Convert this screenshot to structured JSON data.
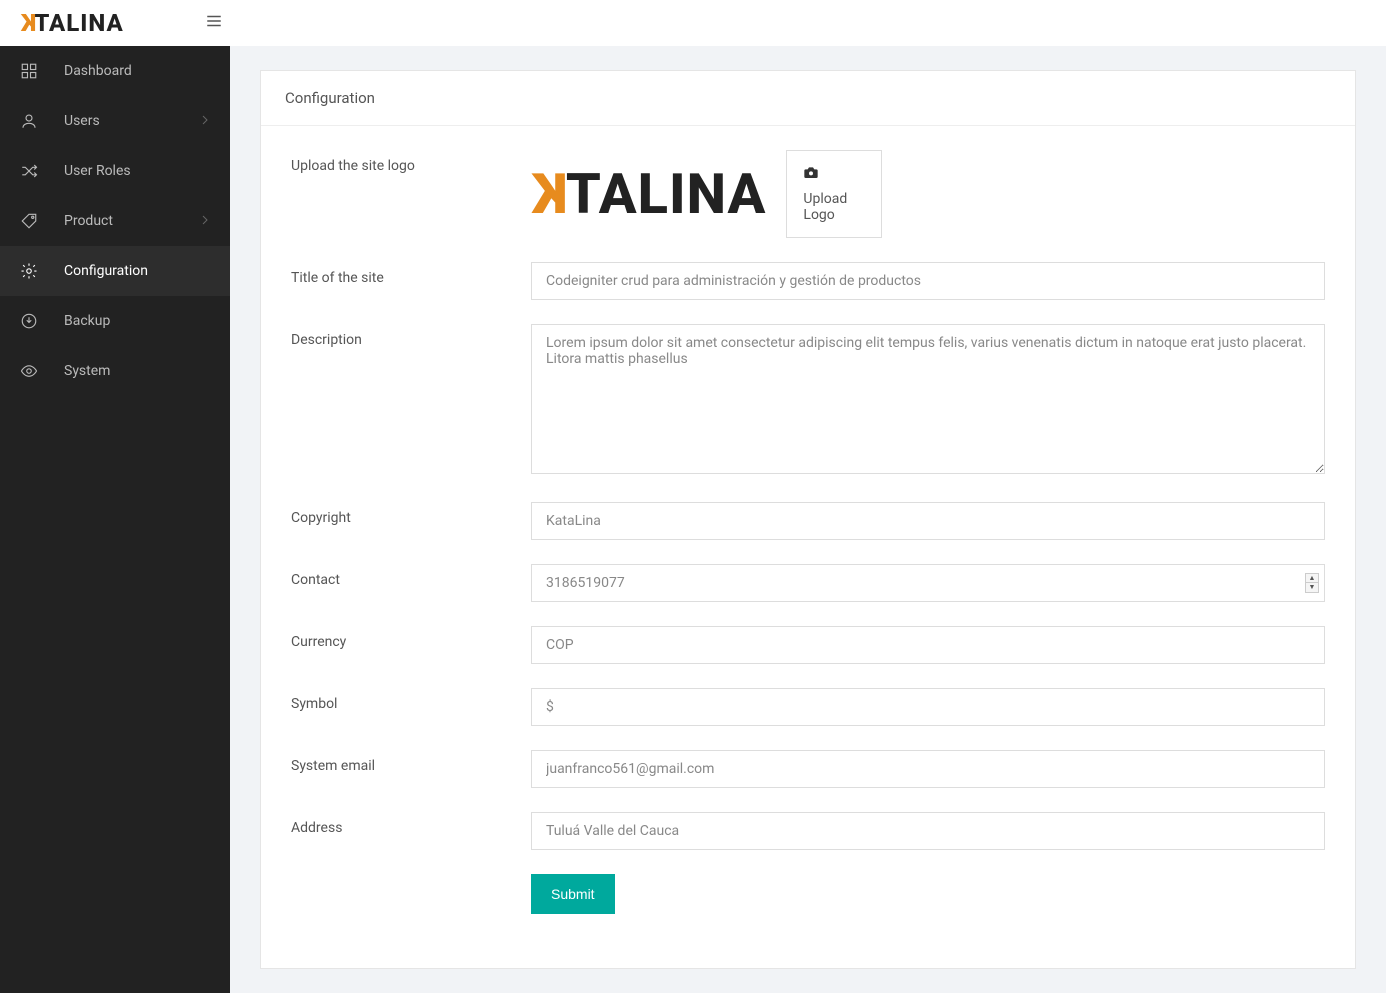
{
  "brand": "TALINA",
  "sidebar": {
    "items": [
      {
        "label": "Dashboard",
        "icon": "grid-icon",
        "chevron": false
      },
      {
        "label": "Users",
        "icon": "user-icon",
        "chevron": true
      },
      {
        "label": "User Roles",
        "icon": "shuffle-icon",
        "chevron": false
      },
      {
        "label": "Product",
        "icon": "tag-icon",
        "chevron": true
      },
      {
        "label": "Configuration",
        "icon": "gear-icon",
        "chevron": false,
        "active": true
      },
      {
        "label": "Backup",
        "icon": "download-icon",
        "chevron": false
      },
      {
        "label": "System",
        "icon": "eye-icon",
        "chevron": false
      }
    ]
  },
  "panel": {
    "title": "Configuration"
  },
  "form": {
    "logo_label": "Upload the site logo",
    "upload_logo": "Upload Logo",
    "title_label": "Title of the site",
    "title_value": "Codeigniter crud para administración y gestión de productos",
    "description_label": "Description",
    "description_value": "Lorem ipsum dolor sit amet consectetur adipiscing elit tempus felis, varius venenatis dictum in natoque erat justo placerat. Litora mattis phasellus",
    "copyright_label": "Copyright",
    "copyright_value": "KataLina",
    "contact_label": "Contact",
    "contact_value": "3186519077",
    "currency_label": "Currency",
    "currency_value": "COP",
    "symbol_label": "Symbol",
    "symbol_value": "$",
    "email_label": "System email",
    "email_value": "juanfranco561@gmail.com",
    "address_label": "Address",
    "address_value": "Tuluá Valle del Cauca",
    "submit": "Submit"
  }
}
